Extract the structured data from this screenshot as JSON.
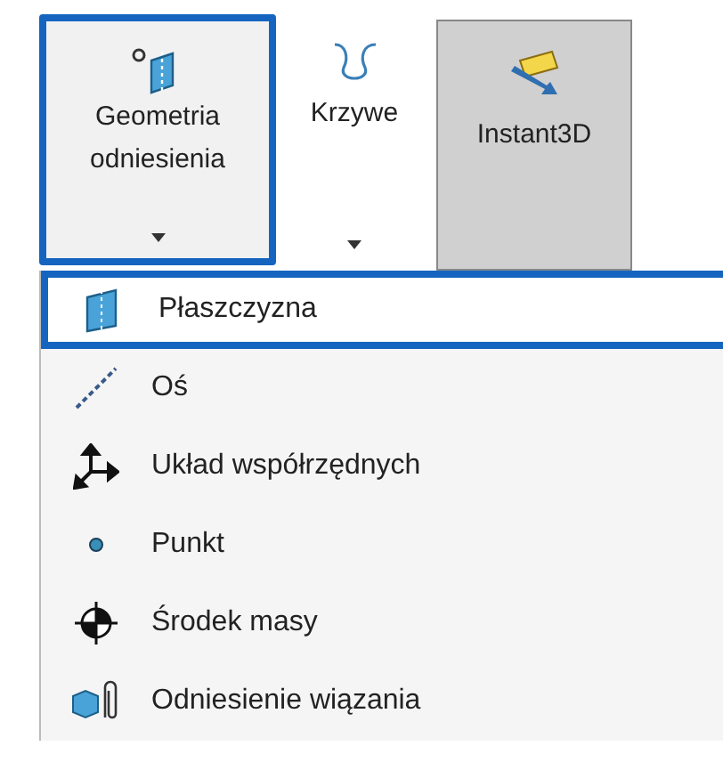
{
  "toolbar": [
    {
      "kind": "reference-geometry",
      "label": "Geometria odniesienia",
      "dropdown": true,
      "highlighted": true,
      "pressed": false
    },
    {
      "kind": "curves",
      "label": "Krzywe",
      "dropdown": true,
      "highlighted": false,
      "pressed": false
    },
    {
      "kind": "instant3d",
      "label": "Instant3D",
      "dropdown": false,
      "highlighted": false,
      "pressed": true
    }
  ],
  "menu": [
    {
      "kind": "plane",
      "label": "Płaszczyzna",
      "highlighted": true
    },
    {
      "kind": "axis",
      "label": "Oś",
      "highlighted": false
    },
    {
      "kind": "coordinate-system",
      "label": "Układ współrzędnych",
      "highlighted": false
    },
    {
      "kind": "point",
      "label": "Punkt",
      "highlighted": false
    },
    {
      "kind": "center-of-mass",
      "label": "Środek masy",
      "highlighted": false
    },
    {
      "kind": "mate-reference",
      "label": "Odniesienie wiązania",
      "highlighted": false
    }
  ]
}
